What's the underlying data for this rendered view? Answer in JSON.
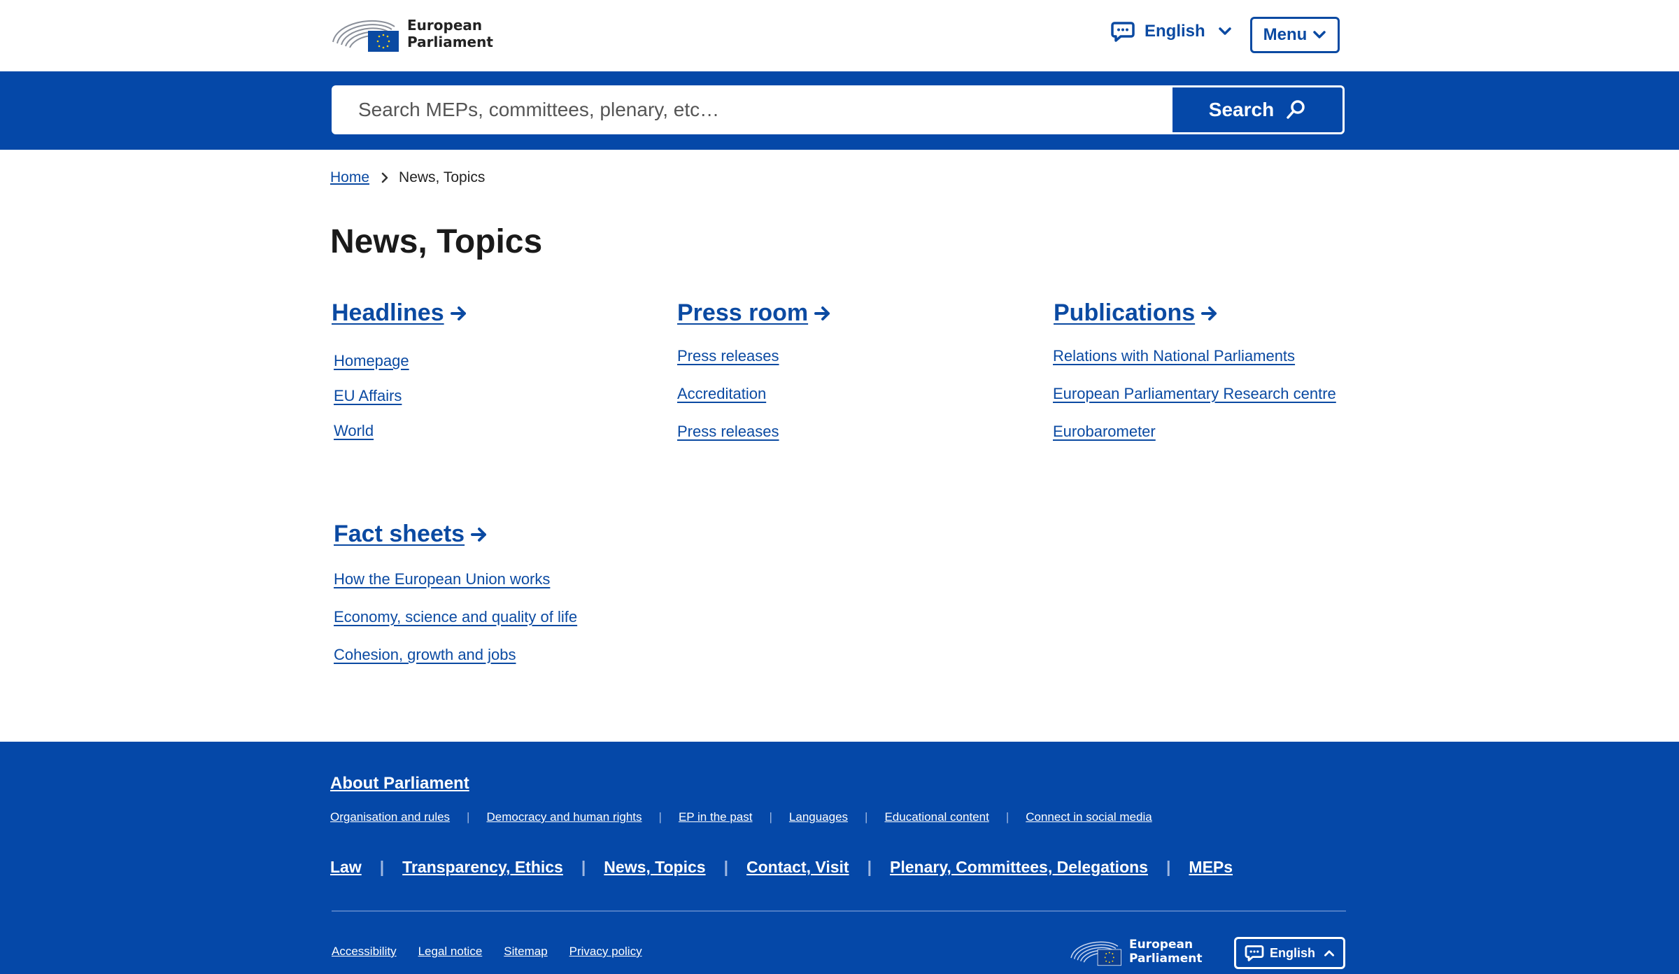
{
  "header": {
    "logo_line1": "European",
    "logo_line2": "Parliament",
    "language": "English",
    "menu_label": "Menu"
  },
  "search": {
    "placeholder": "Search MEPs, committees, plenary, etc…",
    "button_label": "Search"
  },
  "breadcrumb": {
    "home": "Home",
    "current": "News, Topics"
  },
  "page_title": "News, Topics",
  "sections": [
    {
      "title": "Headlines",
      "links": [
        "Homepage",
        "EU Affairs",
        "World"
      ]
    },
    {
      "title": "Press room",
      "links": [
        "Press releases",
        "Accreditation",
        "Press releases"
      ]
    },
    {
      "title": "Publications",
      "links": [
        "Relations with National Parliaments",
        "European Parliamentary Research centre",
        "Eurobarometer"
      ]
    },
    {
      "title": "Fact sheets",
      "links": [
        "How the European Union works",
        "Economy, science and quality of life",
        "Cohesion, growth and jobs"
      ]
    }
  ],
  "footer": {
    "about": "About Parliament",
    "about_links": [
      "Organisation and rules",
      "Democracy and human rights",
      "EP in the past",
      "Languages",
      "Educational content",
      "Connect in social media"
    ],
    "main_links": [
      "Law",
      "Transparency, Ethics",
      "News, Topics",
      "Contact, Visit",
      "Plenary, Committees, Delegations",
      "MEPs"
    ],
    "legal_links": [
      "Accessibility",
      "Legal notice",
      "Sitemap",
      "Privacy policy"
    ],
    "logo_line1": "European",
    "logo_line2": "Parliament",
    "language": "English"
  },
  "colors": {
    "brand_blue": "#0548a8",
    "link_blue": "#0b4aa2"
  },
  "icons": [
    "hemicycle-logo-icon",
    "eu-flag-icon",
    "speech-bubble-icon",
    "chevron-down-icon",
    "magnifier-icon",
    "chevron-right-icon",
    "arrow-right-icon",
    "chevron-up-icon"
  ]
}
